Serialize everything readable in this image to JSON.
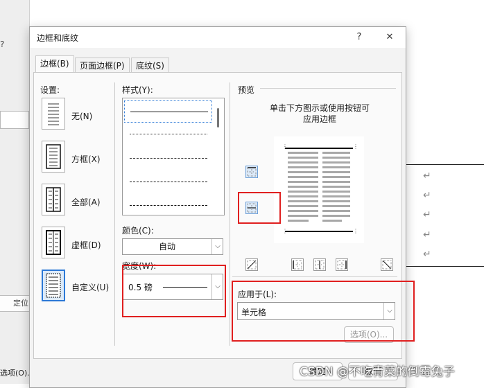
{
  "background": {
    "help_mark": "?",
    "position_button": "定位(P)...",
    "options_label": "选项(O)...",
    "paragraph_marks": [
      "↵",
      "↵",
      "↵",
      "↵",
      "↵"
    ]
  },
  "dialog": {
    "title": "边框和底纹",
    "help_button": "?",
    "close_button": "✕",
    "tabs": [
      {
        "label": "边框(B)",
        "active": true
      },
      {
        "label": "页面边框(P)",
        "active": false
      },
      {
        "label": "底纹(S)",
        "active": false
      }
    ],
    "settings": {
      "heading": "设置:",
      "items": [
        {
          "label": "无(N)",
          "icon": "border-none-icon"
        },
        {
          "label": "方框(X)",
          "icon": "border-box-icon"
        },
        {
          "label": "全部(A)",
          "icon": "border-all-icon"
        },
        {
          "label": "虚框(D)",
          "icon": "border-grid-icon"
        },
        {
          "label": "自定义(U)",
          "icon": "border-custom-icon",
          "selected": true
        }
      ]
    },
    "style": {
      "heading": "样式(Y):",
      "options": [
        "solid",
        "dotted",
        "dashed-small",
        "dashed",
        "dash-dot"
      ]
    },
    "color": {
      "heading": "颜色(C):",
      "value": "自动"
    },
    "width": {
      "heading": "宽度(W):",
      "value": "0.5 磅"
    },
    "preview": {
      "heading": "预览",
      "hint_line1": "单击下方图示或使用按钮可",
      "hint_line2": "应用边框"
    },
    "apply_to": {
      "heading": "应用于(L):",
      "value": "单元格"
    },
    "options_button": "选项(O)...",
    "ok_button": "确定",
    "cancel_button": "取消"
  },
  "watermark": "CSDN @不吃青菜的倒霉兔子",
  "colors": {
    "highlight": "#e01f1f",
    "accent": "#2b78d6",
    "title_bg": "#ffffff"
  }
}
